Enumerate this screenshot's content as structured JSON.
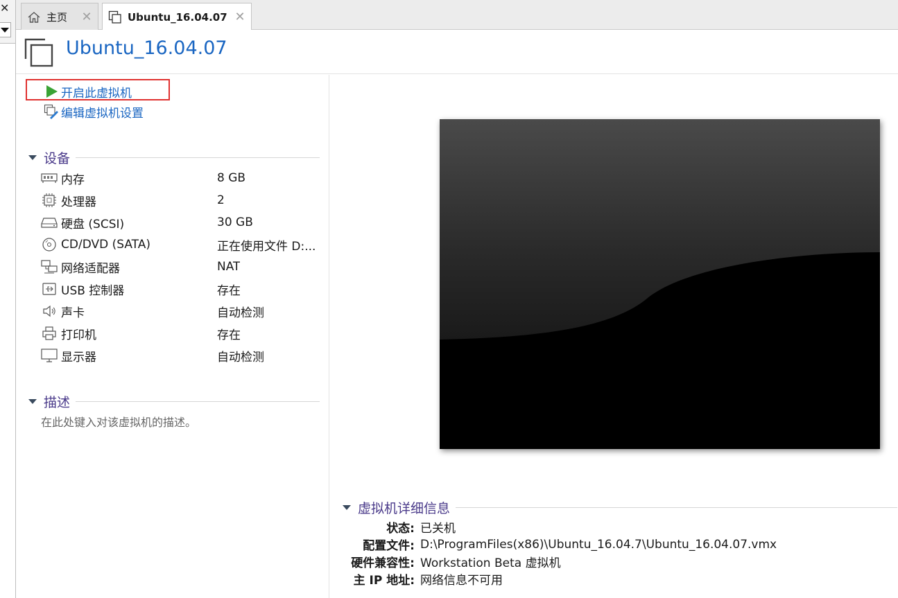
{
  "tabs": [
    {
      "label": "主页",
      "icon": "home-icon"
    },
    {
      "label": "Ubuntu_16.04.07",
      "icon": "vm-icon"
    }
  ],
  "vm": {
    "title": "Ubuntu_16.04.07"
  },
  "actions": {
    "start": "开启此虚拟机",
    "edit": "编辑虚拟机设置"
  },
  "devices_section": {
    "title": "设备",
    "items": [
      {
        "name": "内存",
        "value": "8 GB",
        "icon": "memory-icon"
      },
      {
        "name": "处理器",
        "value": "2",
        "icon": "cpu-icon"
      },
      {
        "name": "硬盘 (SCSI)",
        "value": "30 GB",
        "icon": "harddisk-icon"
      },
      {
        "name": "CD/DVD (SATA)",
        "value": "正在使用文件 D:...",
        "icon": "cd-dvd-icon"
      },
      {
        "name": "网络适配器",
        "value": "NAT",
        "icon": "network-adapter-icon"
      },
      {
        "name": "USB 控制器",
        "value": "存在",
        "icon": "usb-icon"
      },
      {
        "name": "声卡",
        "value": "自动检测",
        "icon": "speaker-icon"
      },
      {
        "name": "打印机",
        "value": "存在",
        "icon": "printer-icon"
      },
      {
        "name": "显示器",
        "value": "自动检测",
        "icon": "monitor-icon"
      }
    ]
  },
  "description_section": {
    "title": "描述",
    "placeholder": "在此处键入对该虚拟机的描述。"
  },
  "details_section": {
    "title": "虚拟机详细信息",
    "rows": [
      {
        "key": "状态:",
        "value": "已关机"
      },
      {
        "key": "配置文件:",
        "value": "D:\\ProgramFiles(x86)\\Ubuntu_16.04.7\\Ubuntu_16.04.07.vmx"
      },
      {
        "key": "硬件兼容性:",
        "value": "Workstation Beta 虚拟机"
      },
      {
        "key": "主 IP 地址:",
        "value": "网络信息不可用"
      }
    ]
  },
  "colors": {
    "accent_blue": "#1a66c2",
    "section_title": "#4a3a8a",
    "highlight_red": "#e0312f",
    "play_green": "#3aa335"
  }
}
